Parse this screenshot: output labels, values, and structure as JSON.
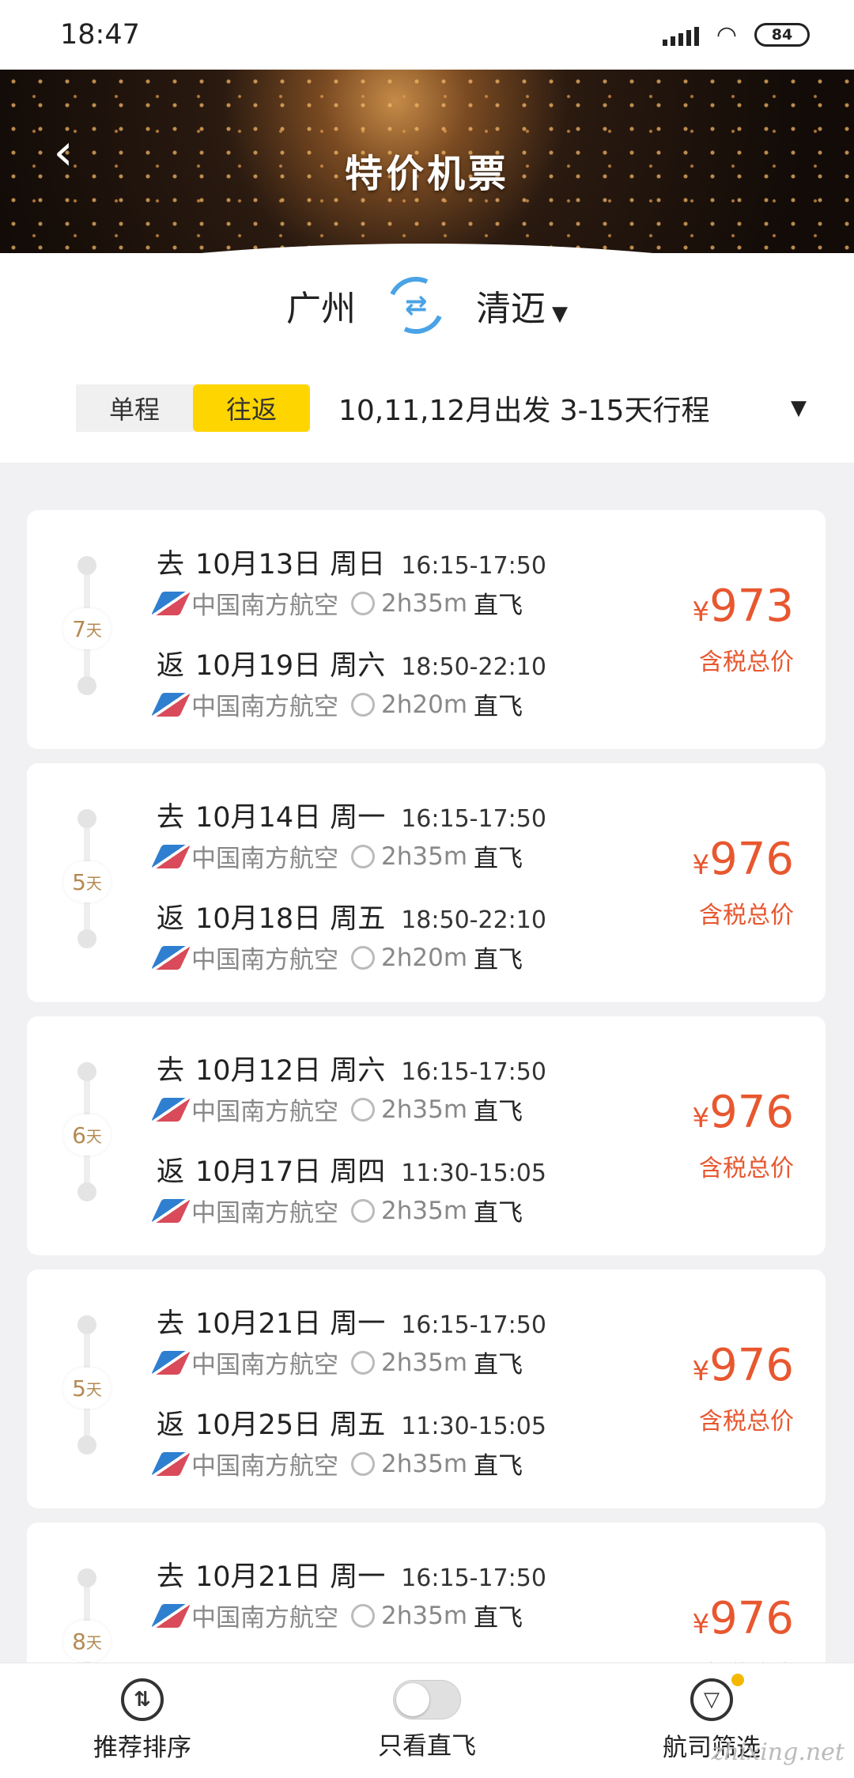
{
  "status_bar": {
    "time": "18:47",
    "battery": "84"
  },
  "header": {
    "title": "特价机票"
  },
  "route": {
    "from": "广州",
    "to": "清迈"
  },
  "trip_type": {
    "one_way": "单程",
    "round_trip": "往返",
    "selected": "往返"
  },
  "date_range": "10,11,12月出发 3-15天行程",
  "cards": [
    {
      "days": "7",
      "days_unit": "天",
      "go": {
        "prefix": "去",
        "date": "10月13日 周日",
        "times": "16:15-17:50",
        "airline": "中国南方航空",
        "duration": "2h35m",
        "type": "直飞"
      },
      "ret": {
        "prefix": "返",
        "date": "10月19日 周六",
        "times": "18:50-22:10",
        "airline": "中国南方航空",
        "duration": "2h20m",
        "type": "直飞"
      },
      "currency": "¥",
      "price": "973",
      "price_note": "含税总价"
    },
    {
      "days": "5",
      "days_unit": "天",
      "go": {
        "prefix": "去",
        "date": "10月14日 周一",
        "times": "16:15-17:50",
        "airline": "中国南方航空",
        "duration": "2h35m",
        "type": "直飞"
      },
      "ret": {
        "prefix": "返",
        "date": "10月18日 周五",
        "times": "18:50-22:10",
        "airline": "中国南方航空",
        "duration": "2h20m",
        "type": "直飞"
      },
      "currency": "¥",
      "price": "976",
      "price_note": "含税总价"
    },
    {
      "days": "6",
      "days_unit": "天",
      "go": {
        "prefix": "去",
        "date": "10月12日 周六",
        "times": "16:15-17:50",
        "airline": "中国南方航空",
        "duration": "2h35m",
        "type": "直飞"
      },
      "ret": {
        "prefix": "返",
        "date": "10月17日 周四",
        "times": "11:30-15:05",
        "airline": "中国南方航空",
        "duration": "2h35m",
        "type": "直飞"
      },
      "currency": "¥",
      "price": "976",
      "price_note": "含税总价"
    },
    {
      "days": "5",
      "days_unit": "天",
      "go": {
        "prefix": "去",
        "date": "10月21日 周一",
        "times": "16:15-17:50",
        "airline": "中国南方航空",
        "duration": "2h35m",
        "type": "直飞"
      },
      "ret": {
        "prefix": "返",
        "date": "10月25日 周五",
        "times": "11:30-15:05",
        "airline": "中国南方航空",
        "duration": "2h35m",
        "type": "直飞"
      },
      "currency": "¥",
      "price": "976",
      "price_note": "含税总价"
    },
    {
      "days": "8",
      "days_unit": "天",
      "go": {
        "prefix": "去",
        "date": "10月21日 周一",
        "times": "16:15-17:50",
        "airline": "中国南方航空",
        "duration": "2h35m",
        "type": "直飞"
      },
      "ret": {
        "prefix": "",
        "date": "",
        "times": "",
        "airline": "",
        "duration": "",
        "type": ""
      },
      "currency": "¥",
      "price": "976",
      "price_note": "含税总价"
    }
  ],
  "bottom_bar": {
    "sort": "推荐排序",
    "direct_only": "只看直飞",
    "airline_filter": "航司筛选"
  },
  "watermark": "zhixing.net",
  "colors": {
    "accent": "#ffd500",
    "price": "#e8572f",
    "swap": "#4aa3e6"
  }
}
